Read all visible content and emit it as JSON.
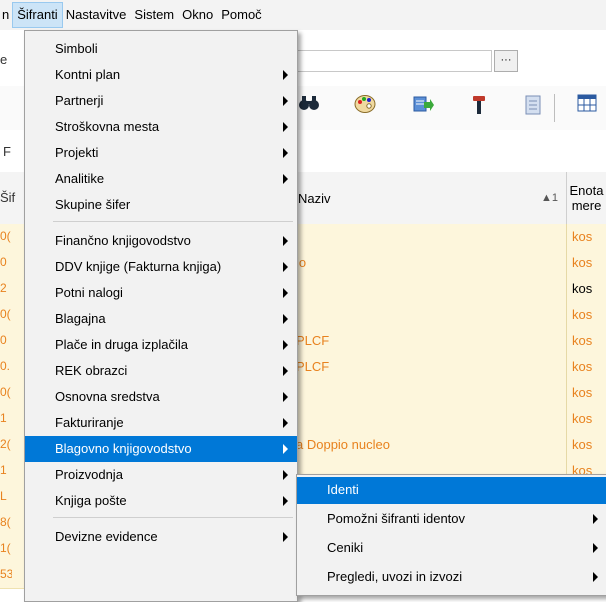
{
  "menubar": {
    "items": [
      {
        "text": "n"
      },
      {
        "text": "Šifranti"
      },
      {
        "text": "Nastavitve"
      },
      {
        "text": "Sistem"
      },
      {
        "text": "Okno"
      },
      {
        "text": "Pomoč"
      }
    ]
  },
  "background": {
    "ellipsis": "···",
    "left_letters": [
      "e",
      "F",
      "Šif"
    ],
    "column_naziv": "Naziv",
    "sort_indicator": "▲1",
    "column_enota_line1": "Enota",
    "column_enota_line2": "mere",
    "rows": [
      {
        "code": "0(",
        "naziv": "",
        "enota": "kos",
        "black": false
      },
      {
        "code": "0",
        "naziv": "io",
        "enota": "kos",
        "black": false
      },
      {
        "code": "2",
        "naziv": "",
        "enota": "kos",
        "black": true
      },
      {
        "code": "0(",
        "naziv": "",
        "enota": "kos",
        "black": false
      },
      {
        "code": "0",
        "naziv": "PLCF",
        "enota": "kos",
        "black": false
      },
      {
        "code": "0.",
        "naziv": "PLCF",
        "enota": "kos",
        "black": false
      },
      {
        "code": "0(",
        "naziv": "",
        "enota": "kos",
        "black": false
      },
      {
        "code": "1",
        "naziv": "",
        "enota": "kos",
        "black": false
      },
      {
        "code": "2(",
        "naziv": "a Doppio nucleo",
        "enota": "kos",
        "black": false
      },
      {
        "code": "1",
        "naziv": "",
        "enota": "kos",
        "black": false
      },
      {
        "code": "L",
        "naziv": "",
        "enota": "",
        "black": false
      },
      {
        "code": "8(",
        "naziv": "",
        "enota": "",
        "black": false
      },
      {
        "code": "1(",
        "naziv": "",
        "enota": "",
        "black": false
      },
      {
        "code": "53",
        "naziv": "",
        "enota": "",
        "black": false
      }
    ]
  },
  "main_menu": {
    "items": [
      {
        "label": "Simboli",
        "submenu": false
      },
      {
        "label": "Kontni plan",
        "submenu": true
      },
      {
        "label": "Partnerji",
        "submenu": true
      },
      {
        "label": "Stroškovna mesta",
        "submenu": true
      },
      {
        "label": "Projekti",
        "submenu": true
      },
      {
        "label": "Analitike",
        "submenu": true
      },
      {
        "label": "Skupine šifer",
        "submenu": false
      },
      {
        "label": "Finančno knjigovodstvo",
        "submenu": true
      },
      {
        "label": "DDV knjige (Fakturna knjiga)",
        "submenu": true
      },
      {
        "label": "Potni nalogi",
        "submenu": true
      },
      {
        "label": "Blagajna",
        "submenu": true
      },
      {
        "label": "Plače in druga izplačila",
        "submenu": true
      },
      {
        "label": "REK obrazci",
        "submenu": true
      },
      {
        "label": "Osnovna sredstva",
        "submenu": true
      },
      {
        "label": "Fakturiranje",
        "submenu": true
      },
      {
        "label": "Blagovno knjigovodstvo",
        "submenu": true
      },
      {
        "label": "Proizvodnja",
        "submenu": true
      },
      {
        "label": "Knjiga pošte",
        "submenu": true
      },
      {
        "label": "Devizne evidence",
        "submenu": true
      }
    ]
  },
  "sub_menu": {
    "items": [
      {
        "label": "Identi",
        "submenu": false
      },
      {
        "label": "Pomožni šifranti identov",
        "submenu": true
      },
      {
        "label": "Ceniki",
        "submenu": true
      },
      {
        "label": "Pregledi, uvozi in izvozi",
        "submenu": true
      }
    ]
  }
}
